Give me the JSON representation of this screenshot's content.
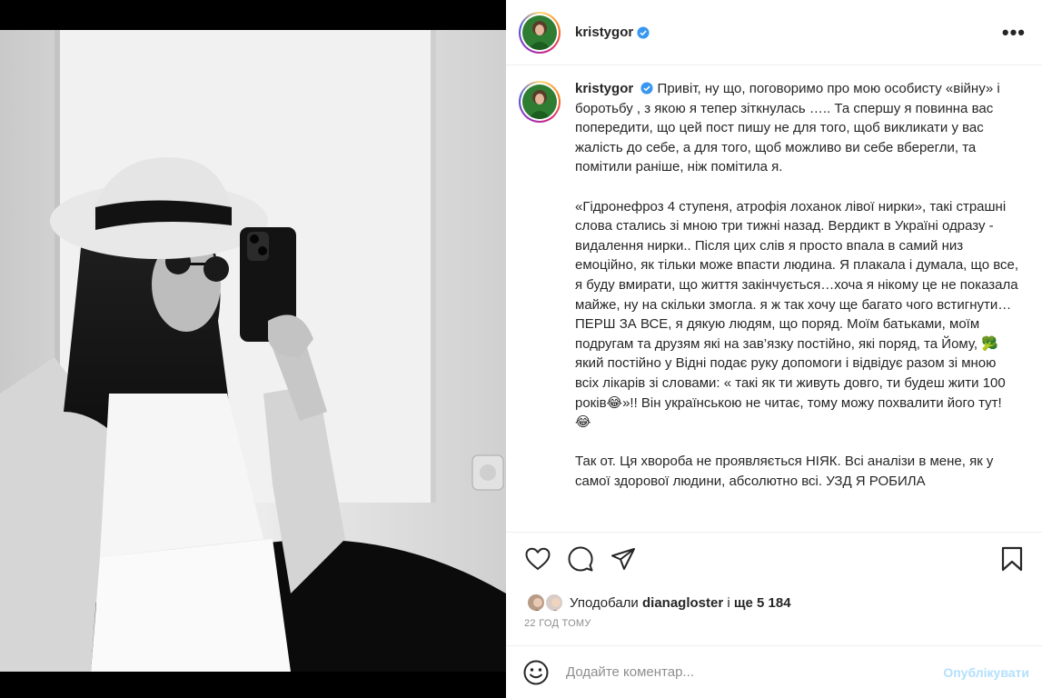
{
  "post": {
    "username": "kristygor",
    "verified": true,
    "more_label": "•••",
    "caption": {
      "paragraph1": "Привіт, ну що, поговоримо про мою особисту «війну» і боротьбу , з якою я тепер зіткнулась ….. Та спершу я повинна вас попередити, що цей пост пишу не для того, щоб викликати у вас жалість до себе, а для того, щоб можливо ви себе вберегли, та помітили раніше, ніж помітила я.",
      "paragraph2": "«Гідронефроз 4 ступеня, атрофія лоханок лівої нирки», такі страшні слова стались зі мною три тижні назад. Вердикт в Україні одразу - видалення нирки.. Після цих слів я просто впала в самий низ емоційно, як тільки може впасти людина. Я плакала і думала, що все, я буду вмирати, що життя закінчується…хоча я нікому це не показала майже, ну на скільки змогла. я ж так хочу ще багато чого встигнути… ПЕРШ ЗА ВСЕ, я дякую людям, що поряд. Моїм батьками, моїм подругам та друзям які на зав’язку постійно, які поряд, та Йому, 🥦 який постійно у Відні подає руку допомоги і відвідує разом зі мною всіх лікарів зі словами: « такі як ти живуть довго, ти будеш жити 100 років😂»!! Він українською не читає, тому можу похвалити його тут! 😂",
      "paragraph3": "Так от. Ця хвороба не проявляється НІЯК. Всі аналізи в мене, як у самої здорової людини, абсолютно всі. УЗД Я РОБИЛА"
    },
    "likes": {
      "prefix": "Уподобали",
      "user": "dianagloster",
      "middle": "і",
      "count_text": "ще 5 184"
    },
    "time": "22 ГОД ТОМУ",
    "comment": {
      "placeholder": "Додайте коментар...",
      "publish_label": "Опублікувати"
    }
  },
  "icons": [
    "more-icon",
    "verified-icon",
    "heart-icon",
    "comment-icon",
    "share-icon",
    "bookmark-icon",
    "emoji-icon"
  ],
  "colors": {
    "verified": "#3897f0",
    "publish_disabled": "#b2dffc",
    "muted": "#8e8e8e",
    "text": "#262626"
  }
}
